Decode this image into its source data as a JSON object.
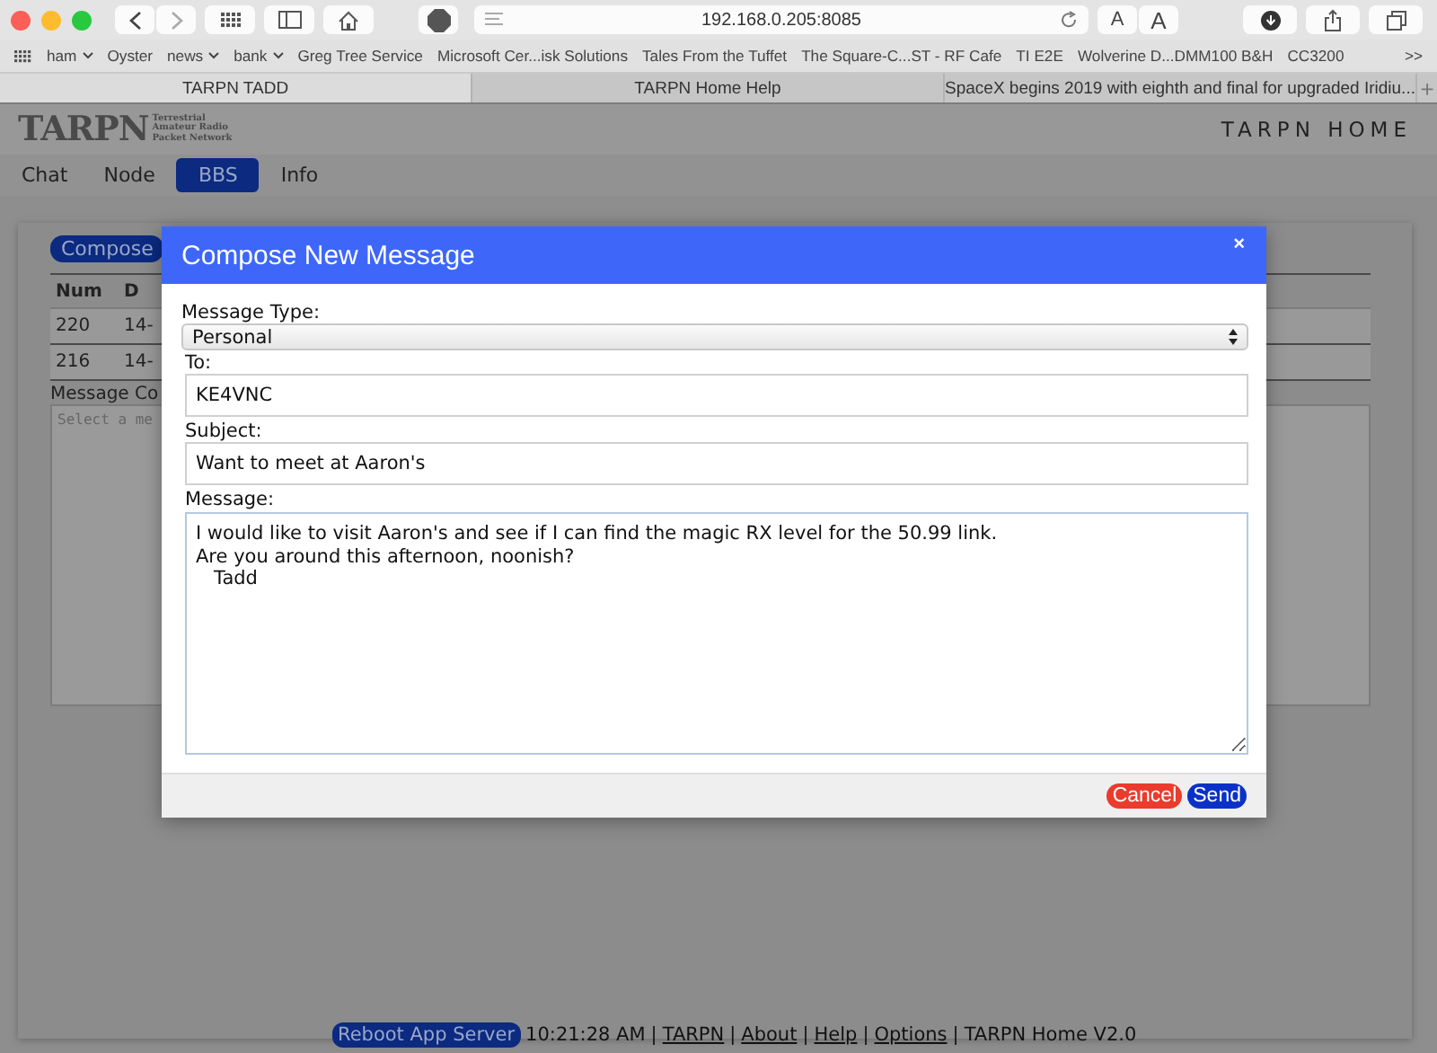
{
  "browser": {
    "address": "192.168.0.205:8085",
    "text_size_buttons": [
      "A",
      "A"
    ],
    "bookmarks": [
      {
        "label": "ham",
        "menu": true
      },
      {
        "label": "Oyster",
        "menu": false
      },
      {
        "label": "news",
        "menu": true
      },
      {
        "label": "bank",
        "menu": true
      },
      {
        "label": "Greg Tree Service",
        "menu": false
      },
      {
        "label": "Microsoft Cer...isk Solutions",
        "menu": false
      },
      {
        "label": "Tales From the Tuffet",
        "menu": false
      },
      {
        "label": "The Square-C...ST - RF Cafe",
        "menu": false
      },
      {
        "label": "TI E2E",
        "menu": false
      },
      {
        "label": "Wolverine D...DMM100 B&H",
        "menu": false
      },
      {
        "label": "CC3200",
        "menu": false
      }
    ],
    "bookmarks_more": ">>",
    "tabs": [
      {
        "label": "TARPN TADD",
        "selected": true
      },
      {
        "label": "TARPN Home Help",
        "selected": false
      },
      {
        "label": "SpaceX begins 2019 with eighth and final for upgraded Iridiu...",
        "selected": false
      }
    ],
    "new_tab": "+"
  },
  "page": {
    "logo": {
      "name": "TARPN",
      "tagline": [
        "Terrestrial",
        "Amateur Radio",
        "Packet Network"
      ]
    },
    "home_title": "TARPN HOME",
    "nav": [
      {
        "label": "Chat",
        "selected": false
      },
      {
        "label": "Node",
        "selected": false
      },
      {
        "label": "BBS",
        "selected": true
      },
      {
        "label": "Info",
        "selected": false
      }
    ],
    "compose_button": "Compose",
    "table": {
      "columns": [
        "Num",
        "D"
      ],
      "rows": [
        [
          "220",
          "14-"
        ],
        [
          "216",
          "14-"
        ]
      ]
    },
    "message_content_label": "Message Co",
    "message_content_placeholder": "Select a me"
  },
  "dialog": {
    "title": "Compose New Message",
    "close": "×",
    "fields": [
      {
        "kind": "select",
        "label": "Message Type:",
        "value": "Personal"
      },
      {
        "kind": "text",
        "label": "To:",
        "value": "KE4VNC"
      },
      {
        "kind": "text",
        "label": "Subject:",
        "value": "Want to meet at Aaron's"
      },
      {
        "kind": "textarea",
        "label": "Message:",
        "value": "I would like to visit Aaron's and see if I can find the magic RX level for the 50.99 link.\nAre you around this afternoon, noonish?\n   Tadd"
      }
    ],
    "buttons": [
      {
        "kind": "cancel",
        "label": "Cancel"
      },
      {
        "kind": "send",
        "label": "Send"
      }
    ]
  },
  "footer": {
    "reboot_button": "Reboot App Server",
    "time": "10:21:28 AM",
    "separator": "|",
    "links": [
      "TARPN",
      "About",
      "Help",
      "Options"
    ],
    "version": "TARPN Home V2.0"
  }
}
